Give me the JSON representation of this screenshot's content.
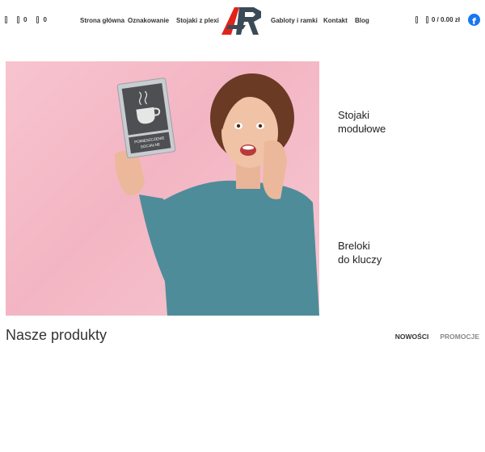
{
  "header": {
    "wishlist_count": "0",
    "compare_count": "0",
    "nav_left": [
      "Strona główna",
      "Oznakowanie",
      "Stojaki z plexi"
    ],
    "nav_right": [
      "Gabloty i ramki",
      "Kontakt",
      "Blog"
    ],
    "cart_label": "0 / 0.00 zł",
    "facebook_glyph": "f"
  },
  "hero": {
    "sign_line1": "POMIESZCZENIE",
    "sign_line2": "SOCJALNE"
  },
  "side_links": [
    {
      "line1": "Stojaki",
      "line2": "modułowe"
    },
    {
      "line1": "Breloki",
      "line2": "do kluczy"
    }
  ],
  "products": {
    "title": "Nasze produkty",
    "tabs": [
      "NOWOŚCI",
      "PROMOCJE"
    ]
  },
  "colors": {
    "logo_red": "#e2231a",
    "logo_dark": "#3b4a57",
    "facebook": "#1877f2",
    "hero_pink": "#f3b5c3"
  },
  "icons": [
    "box-icon",
    "heart-icon",
    "compare-icon",
    "search-icon",
    "cart-icon",
    "facebook-icon"
  ]
}
